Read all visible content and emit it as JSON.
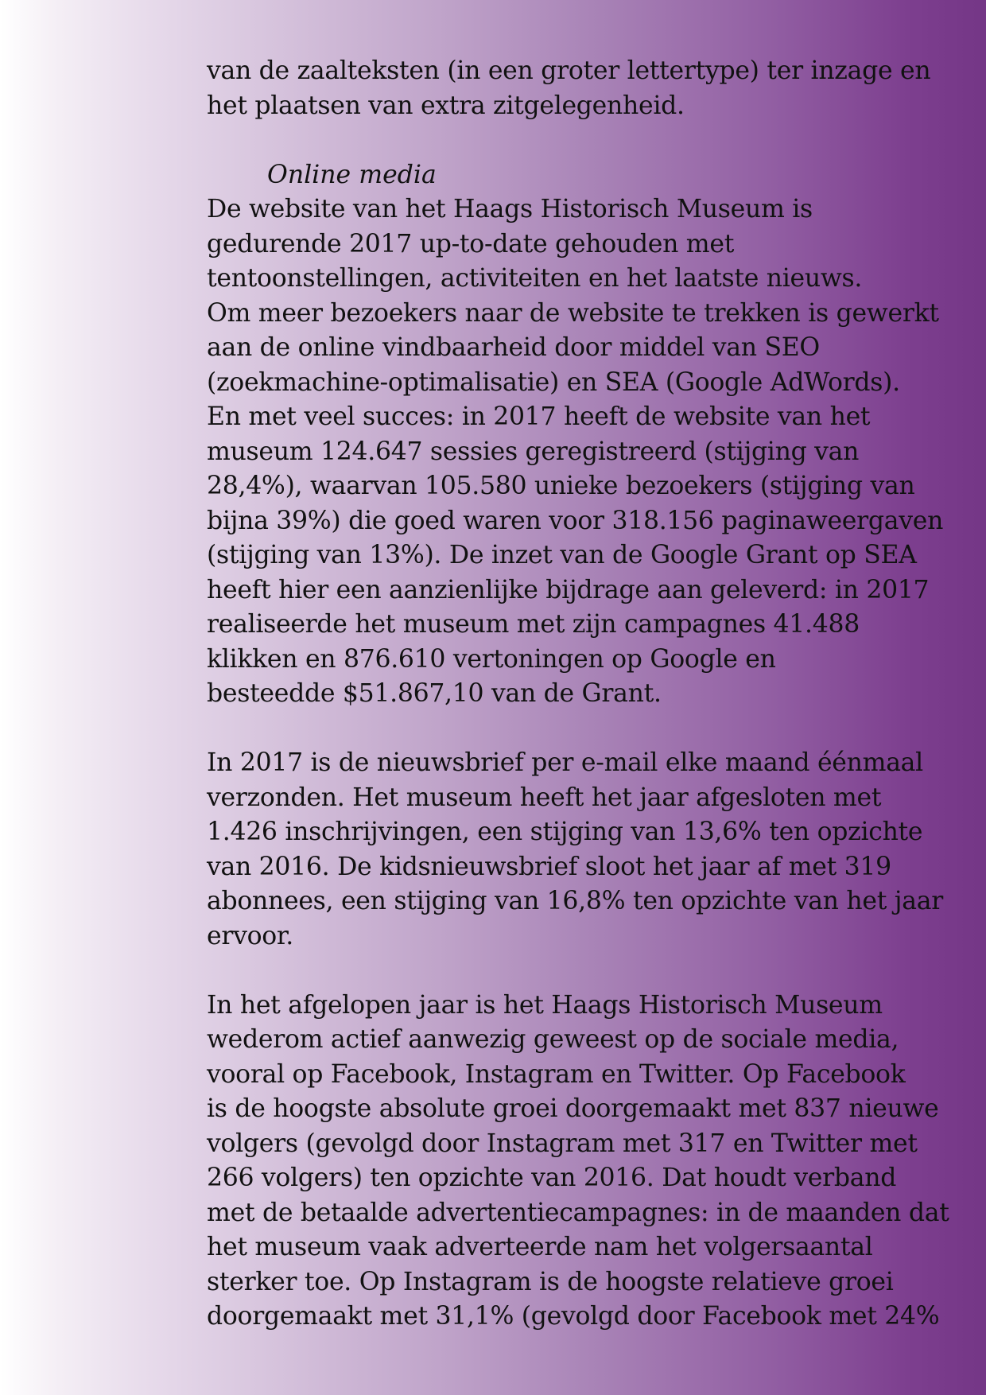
{
  "intro_lines": [
    "van de zaalteksten (in een groter lettertype) ter inzage en",
    "het plaatsen van extra zitgelegenheid."
  ],
  "section_heading": "Online media",
  "paragraph1_lines": [
    "De website van het Haags Historisch Museum is",
    "gedurende 2017 up-to-date gehouden met",
    "tentoonstellingen, activiteiten en het laatste nieuws.",
    "Om meer bezoekers naar de website te trekken is gewerkt",
    "aan de online vindbaarheid door middel van SEO",
    "(zoekmachine-optimalisatie) en SEA (Google AdWords).",
    "En met veel succes: in 2017 heeft de website van het",
    "museum 124.647 sessies geregistreerd (stijging van",
    "28,4%), waarvan 105.580 unieke bezoekers (stijging van",
    "bijna 39%) die goed waren voor 318.156 paginaweergaven",
    "(stijging van 13%). De inzet van de Google Grant op SEA",
    "heeft hier een aanzienlijke bijdrage aan geleverd: in 2017",
    "realiseerde het museum met zijn campagnes 41.488",
    "klikken en 876.610 vertoningen op Google en",
    "besteedde $51.867,10 van de Grant."
  ],
  "paragraph2_lines": [
    "In 2017 is de nieuwsbrief per e-mail elke maand éénmaal",
    "verzonden. Het museum heeft het jaar afgesloten met",
    "1.426 inschrijvingen, een stijging van 13,6% ten opzichte",
    "van 2016. De kidsnieuwsbrief sloot het jaar af met 319",
    "abonnees, een stijging van 16,8% ten opzichte van het jaar",
    "ervoor."
  ],
  "paragraph3_lines": [
    "In het afgelopen jaar is het Haags Historisch Museum",
    "wederom actief aanwezig geweest op de sociale media,",
    "vooral op Facebook, Instagram en Twitter. Op Facebook",
    "is de hoogste absolute groei doorgemaakt met 837 nieuwe",
    "volgers (gevolgd door Instagram met 317 en Twitter met",
    "266 volgers) ten opzichte van 2016. Dat houdt verband",
    "met de betaalde advertentiecampagnes: in de maanden dat",
    "het museum vaak adverteerde nam het volgersaantal",
    "sterker toe. Op Instagram is de hoogste relatieve groei",
    "doorgemaakt met 31,1% (gevolgd door Facebook met 24%"
  ]
}
